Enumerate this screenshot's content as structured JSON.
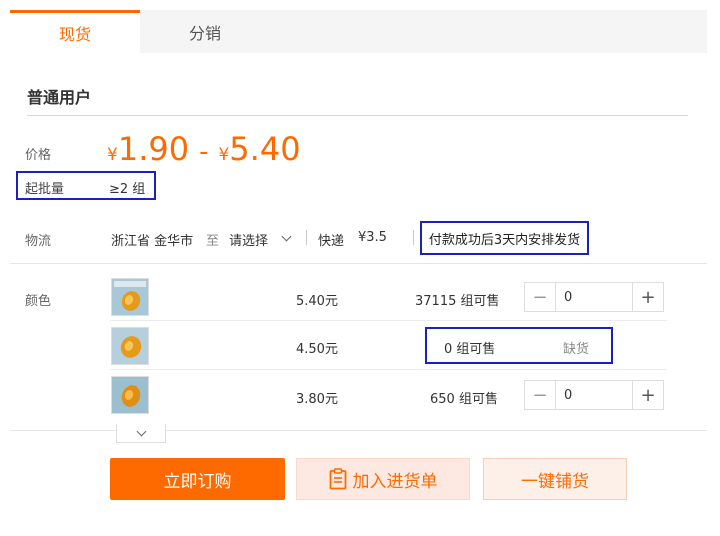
{
  "tabs": [
    {
      "label": "现货",
      "active": true
    },
    {
      "label": "分销",
      "active": false
    }
  ],
  "user_type": "普通用户",
  "price": {
    "label": "价格",
    "currency": "¥",
    "min": "1.90",
    "separator": "-",
    "max": "5.40"
  },
  "moq": {
    "label": "起批量",
    "value": "≥2 组"
  },
  "logistics": {
    "label": "物流",
    "origin": "浙江省 金华市",
    "to": "至",
    "destination_placeholder": "请选择",
    "method": "快递",
    "fee": "¥3.5",
    "ship_note": "付款成功后3天内安排发货"
  },
  "color": {
    "label": "颜色",
    "skus": [
      {
        "price": "5.40元",
        "stock": "37115 组可售",
        "quantity": "0",
        "available": true
      },
      {
        "price": "4.50元",
        "stock": "0 组可售",
        "status": "缺货",
        "available": false
      },
      {
        "price": "3.80元",
        "stock": "650 组可售",
        "quantity": "0",
        "available": true
      }
    ]
  },
  "actions": {
    "buy_now": "立即订购",
    "add_to_list": "加入进货单",
    "one_click_distribute": "一键铺货"
  },
  "colors": {
    "accent": "#ff6a00",
    "highlight_border": "#1a22b8"
  },
  "icons": {
    "expand": "chevron-down-icon",
    "add_to_list": "clipboard-icon",
    "destination": "chevron-down-icon",
    "stepper_minus": "minus-icon",
    "stepper_plus": "plus-icon"
  }
}
